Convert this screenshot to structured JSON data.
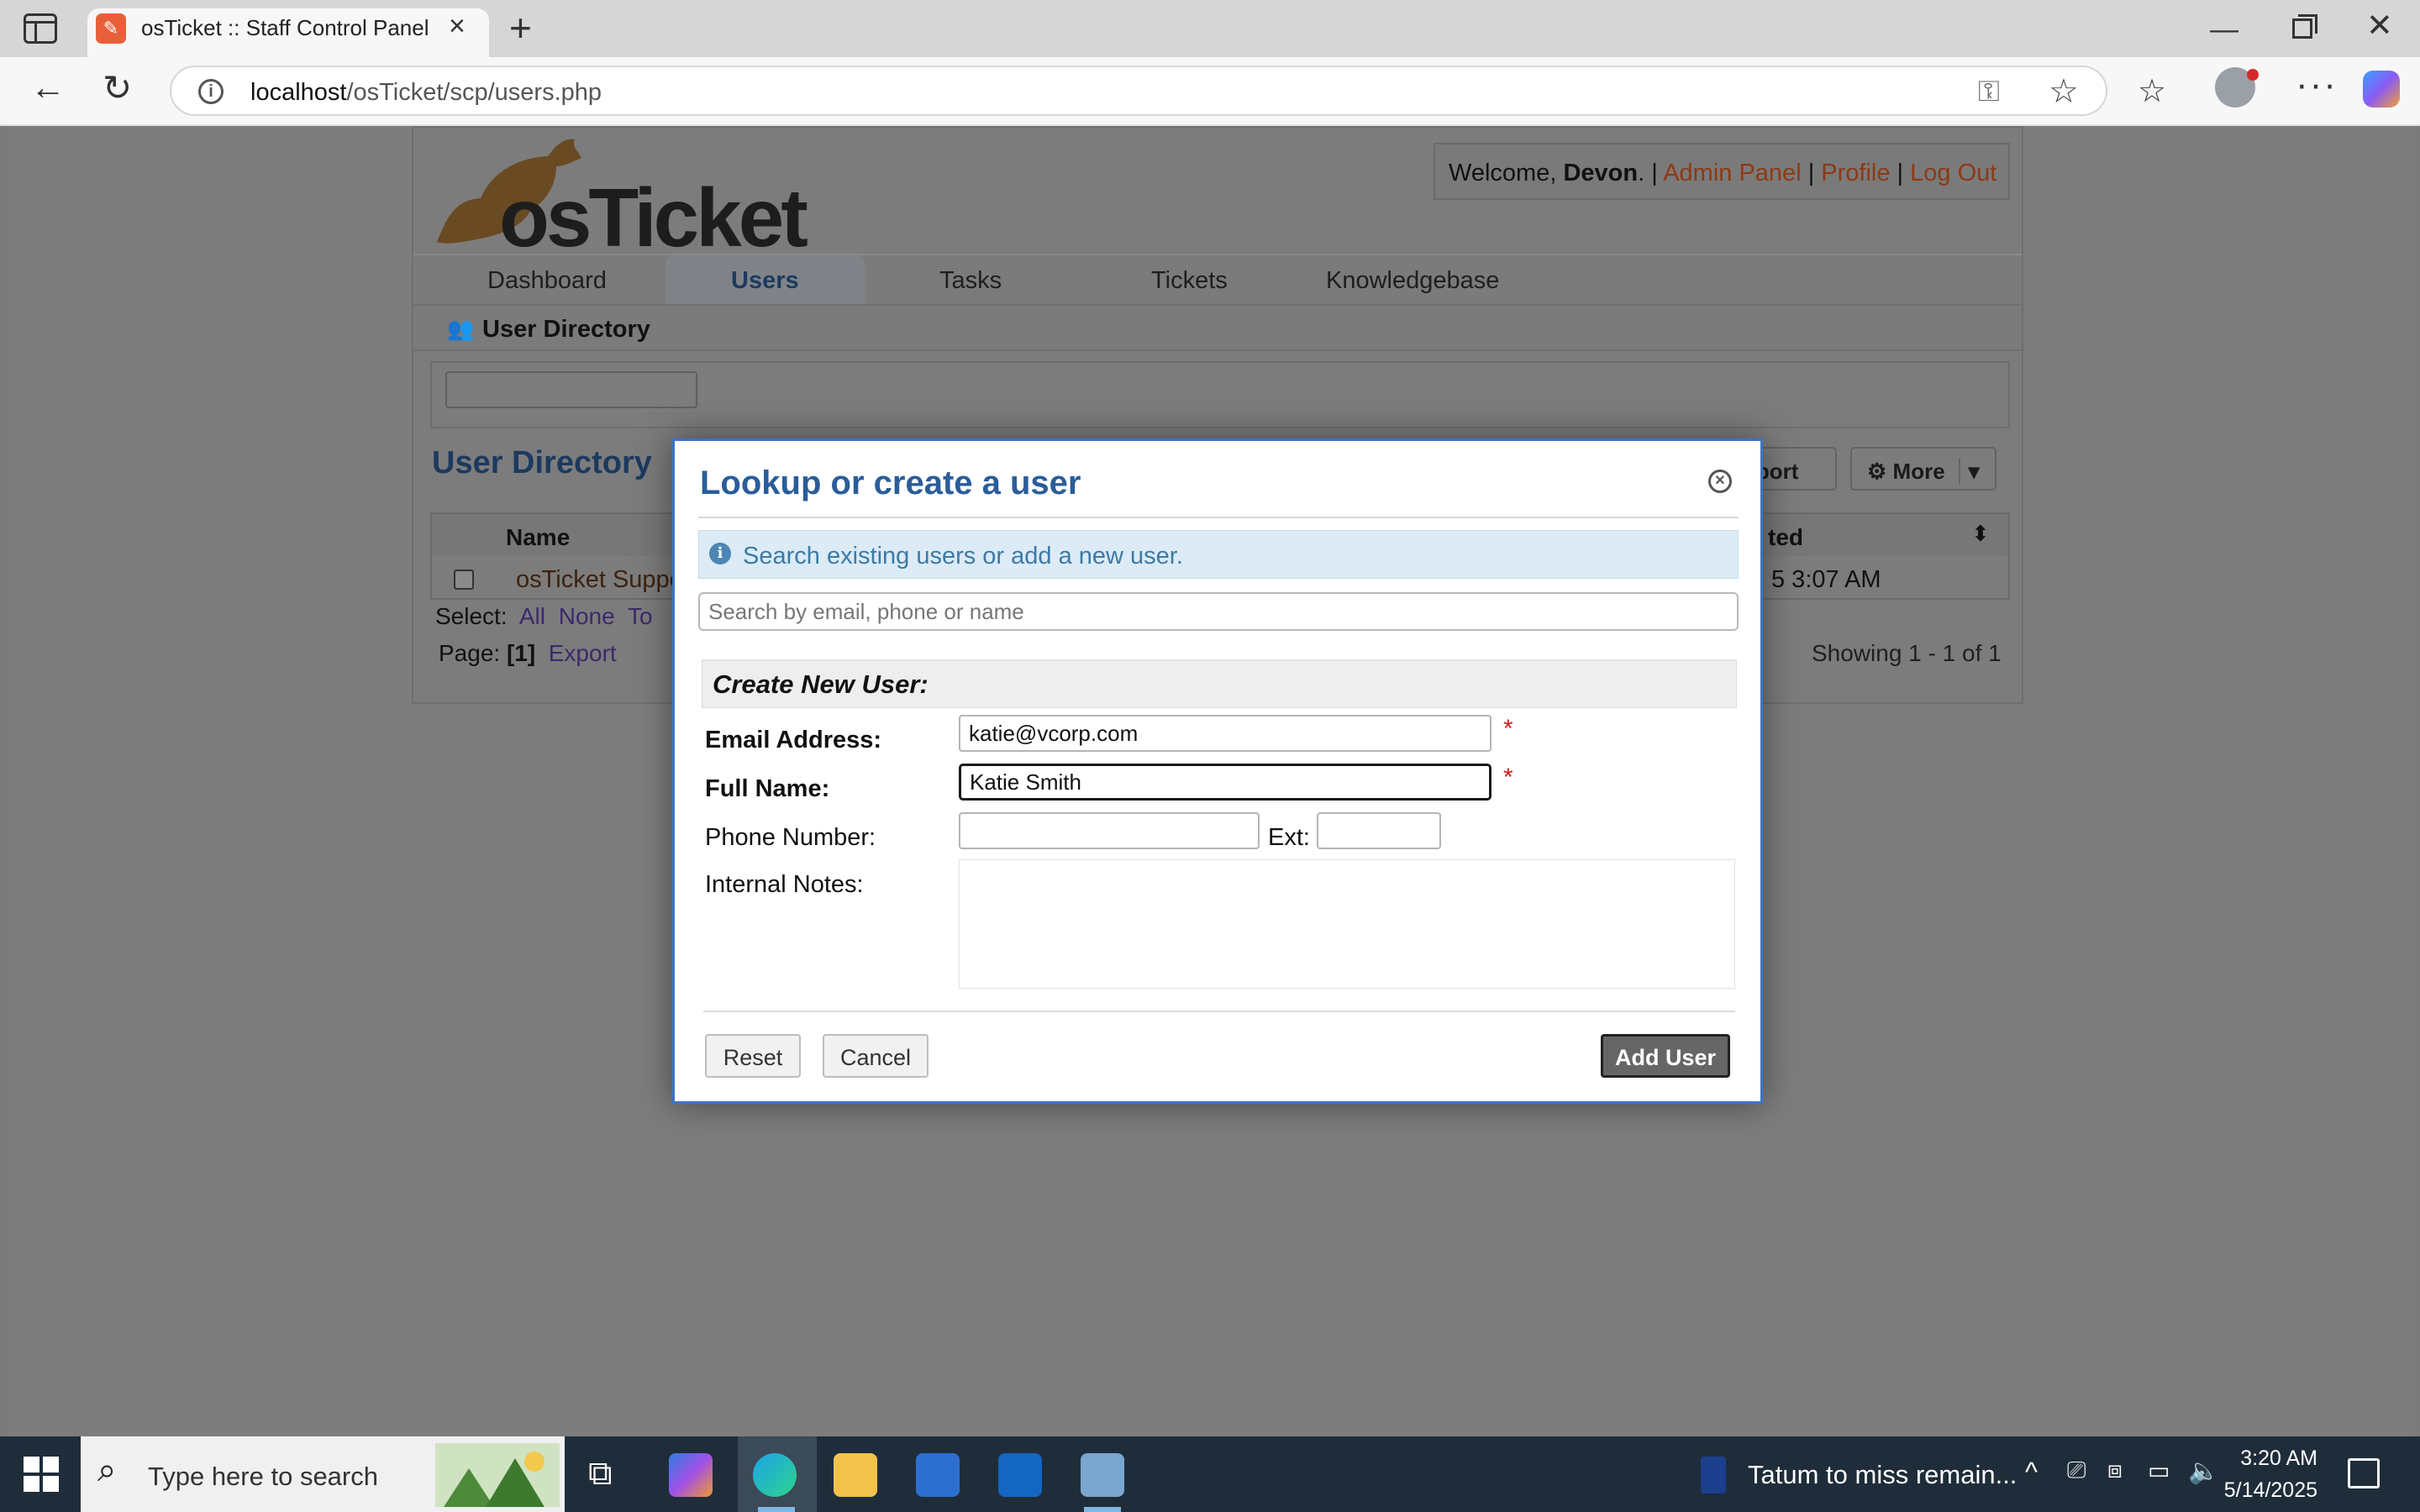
{
  "browser": {
    "tab_title": "osTicket :: Staff Control Panel",
    "url_host": "localhost",
    "url_path": "/osTicket/scp/users.php"
  },
  "header": {
    "welcome_prefix": "Welcome, ",
    "user_name": "Devon",
    "welcome_suffix": ". | ",
    "admin_panel": "Admin Panel",
    "sep1": " | ",
    "profile": "Profile",
    "sep2": " | ",
    "log_out": "Log Out",
    "logo_text": "osTicket"
  },
  "nav": {
    "tabs": [
      {
        "label": "Dashboard"
      },
      {
        "label": "Users"
      },
      {
        "label": "Tasks"
      },
      {
        "label": "Tickets"
      },
      {
        "label": "Knowledgebase"
      }
    ],
    "sub_item": "User Directory"
  },
  "directory": {
    "title": "User Directory",
    "import_label": "nport",
    "more_label": "More",
    "col_name": "Name",
    "col_created": "ted",
    "row_name": "osTicket Suppo",
    "row_date": "5 3:07 AM",
    "select_label": "Select:",
    "select_all": "All",
    "select_none": "None",
    "select_toggle": "To",
    "page_label": "Page:",
    "page_current": "[1]",
    "export_label": "Export",
    "showing": "Showing 1 - 1 of 1"
  },
  "modal": {
    "title": "Lookup or create a user",
    "info_text": "Search existing users or add a new user.",
    "search_placeholder": "Search by email, phone or name",
    "form_heading": "Create New User:",
    "email_label": "Email Address:",
    "email_value": "katie@vcorp.com",
    "fullname_label": "Full Name:",
    "fullname_value": "Katie Smith",
    "phone_label": "Phone Number:",
    "phone_value": "",
    "ext_label": "Ext:",
    "ext_value": "",
    "notes_label": "Internal Notes:",
    "required_mark": "*",
    "reset_label": "Reset",
    "cancel_label": "Cancel",
    "add_label": "Add User"
  },
  "taskbar": {
    "search_placeholder": "Type here to search",
    "news_text": "Tatum to miss remain...",
    "time": "3:20 AM",
    "date": "5/14/2025"
  }
}
